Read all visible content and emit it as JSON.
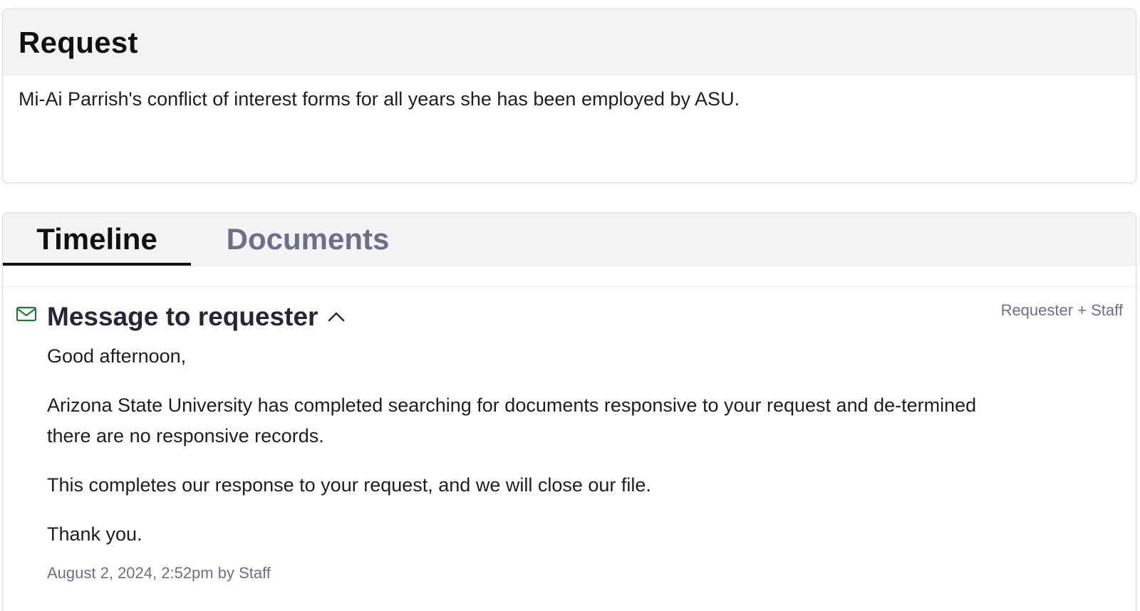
{
  "request": {
    "title": "Request",
    "body": "Mi-Ai Parrish's conflict of interest forms for all years she has been employed by ASU."
  },
  "tabs": {
    "timeline": "Timeline",
    "documents": "Documents"
  },
  "entry": {
    "icon": "envelope-icon",
    "title": "Message to requester",
    "visibility": "Requester + Staff",
    "paragraphs": [
      "Good afternoon,",
      "Arizona State University has completed searching for documents responsive to your request and de-termined there are no responsive records.",
      "This completes our response to your request, and we will close our file.",
      "Thank you."
    ],
    "meta": "August 2, 2024, 2:52pm by Staff"
  },
  "colors": {
    "icon_green": "#1f7a3a",
    "chevron_navy": "#1c2a6b",
    "muted_text": "#6e6e8a"
  }
}
